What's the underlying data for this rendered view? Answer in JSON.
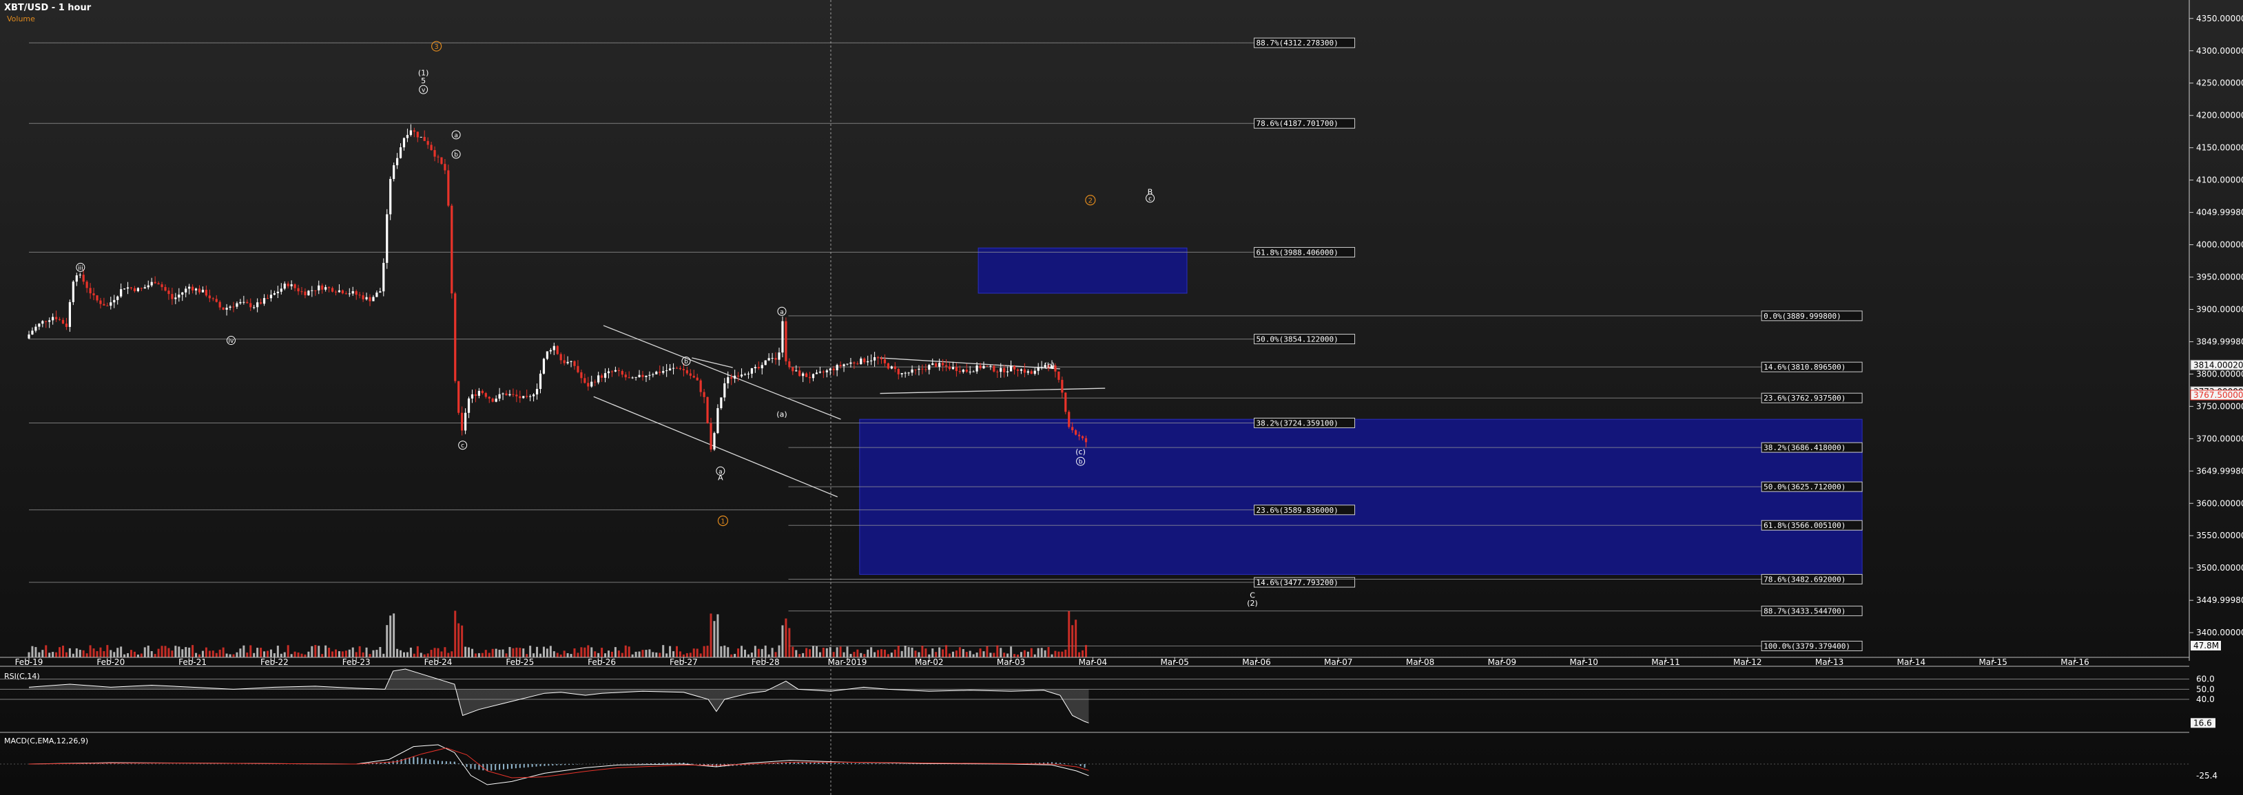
{
  "header": {
    "title": "XBT/USD - 1 hour",
    "subtitle": "Volume"
  },
  "colors": {
    "background": "#0f0f0f",
    "up_candle": "#ffffff",
    "down_candle": "#e8332a",
    "fib_box": "#13157a",
    "fib_line": "#9a9a9a",
    "wave_orange": "#e08a1e",
    "rsi_line": "#ffffff",
    "macd_line": "#ffffff",
    "signal_line": "#e8332a",
    "histogram": "#8fb3c9"
  },
  "chart_data": {
    "type": "candlestick",
    "price_axis": {
      "ylim": [
        3365,
        4370
      ],
      "ticks": [
        "4350.000000",
        "4300.000000",
        "4250.000000",
        "4200.000000",
        "4150.000000",
        "4100.000000",
        "4049.999800",
        "4000.000000",
        "3950.000000",
        "3900.000000",
        "3849.999800",
        "3800.000000",
        "3750.000000",
        "3700.000000",
        "3649.999800",
        "3600.000000",
        "3550.000000",
        "3500.000000",
        "3449.999800",
        "3400.000000"
      ],
      "tick_values": [
        4350,
        4300,
        4250,
        4200,
        4150,
        4100,
        4050,
        4000,
        3950,
        3900,
        3850,
        3800,
        3750,
        3700,
        3650,
        3600,
        3550,
        3500,
        3450,
        3400
      ],
      "price_tags": [
        {
          "label": "3814.000200",
          "value": 3814,
          "style": "plain"
        },
        {
          "label": "3773.000000",
          "value": 3773,
          "style": "plain"
        },
        {
          "label": "3767.500000",
          "value": 3767.5,
          "style": "red"
        }
      ],
      "volume_tag": "47.8M"
    },
    "time_axis": {
      "labels": [
        "Feb-19",
        "Feb-20",
        "Feb-21",
        "Feb-22",
        "Feb-23",
        "Feb-24",
        "Feb-25",
        "Feb-26",
        "Feb-27",
        "Feb-28",
        "Mar-2019",
        "Mar-02",
        "Mar-03",
        "Mar-04",
        "Mar-05",
        "Mar-06",
        "Mar-07",
        "Mar-08",
        "Mar-09",
        "Mar-10",
        "Mar-11",
        "Mar-12",
        "Mar-13",
        "Mar-14",
        "Mar-15",
        "Mar-16"
      ],
      "day_index": [
        0,
        1,
        2,
        3,
        4,
        5,
        6,
        7,
        8,
        9,
        10,
        11,
        12,
        13,
        14,
        15,
        16,
        17,
        18,
        19,
        20,
        21,
        22,
        23,
        24,
        25
      ]
    },
    "price_path": [
      [
        0.0,
        3855
      ],
      [
        0.1,
        3870
      ],
      [
        0.2,
        3880
      ],
      [
        0.35,
        3890
      ],
      [
        0.5,
        3875
      ],
      [
        0.6,
        3960
      ],
      [
        0.7,
        3945
      ],
      [
        0.85,
        3915
      ],
      [
        1.0,
        3905
      ],
      [
        1.2,
        3935
      ],
      [
        1.4,
        3930
      ],
      [
        1.6,
        3945
      ],
      [
        1.8,
        3915
      ],
      [
        2.0,
        3935
      ],
      [
        2.2,
        3925
      ],
      [
        2.4,
        3900
      ],
      [
        2.6,
        3910
      ],
      [
        2.8,
        3905
      ],
      [
        3.0,
        3920
      ],
      [
        3.2,
        3940
      ],
      [
        3.4,
        3925
      ],
      [
        3.6,
        3935
      ],
      [
        3.8,
        3930
      ],
      [
        4.0,
        3925
      ],
      [
        4.2,
        3915
      ],
      [
        4.35,
        3930
      ],
      [
        4.45,
        4100
      ],
      [
        4.55,
        4140
      ],
      [
        4.62,
        4165
      ],
      [
        4.7,
        4180
      ],
      [
        4.78,
        4170
      ],
      [
        4.9,
        4160
      ],
      [
        5.0,
        4140
      ],
      [
        5.15,
        4110
      ],
      [
        5.25,
        3790
      ],
      [
        5.32,
        3700
      ],
      [
        5.4,
        3760
      ],
      [
        5.55,
        3775
      ],
      [
        5.7,
        3760
      ],
      [
        5.85,
        3770
      ],
      [
        6.0,
        3765
      ],
      [
        6.15,
        3760
      ],
      [
        6.25,
        3780
      ],
      [
        6.35,
        3830
      ],
      [
        6.45,
        3845
      ],
      [
        6.55,
        3820
      ],
      [
        6.7,
        3815
      ],
      [
        6.85,
        3780
      ],
      [
        7.0,
        3795
      ],
      [
        7.2,
        3805
      ],
      [
        7.4,
        3790
      ],
      [
        7.6,
        3800
      ],
      [
        7.8,
        3805
      ],
      [
        8.0,
        3810
      ],
      [
        8.1,
        3800
      ],
      [
        8.2,
        3790
      ],
      [
        8.3,
        3760
      ],
      [
        8.38,
        3675
      ],
      [
        8.45,
        3740
      ],
      [
        8.55,
        3790
      ],
      [
        8.7,
        3800
      ],
      [
        8.85,
        3805
      ],
      [
        9.0,
        3810
      ],
      [
        9.1,
        3830
      ],
      [
        9.2,
        3820
      ],
      [
        9.25,
        3885
      ],
      [
        9.3,
        3810
      ],
      [
        9.45,
        3800
      ],
      [
        9.6,
        3795
      ],
      [
        9.8,
        3805
      ],
      [
        10.0,
        3815
      ],
      [
        10.2,
        3820
      ],
      [
        10.4,
        3825
      ],
      [
        10.5,
        3815
      ],
      [
        10.7,
        3800
      ],
      [
        10.9,
        3805
      ],
      [
        11.1,
        3815
      ],
      [
        11.3,
        3810
      ],
      [
        11.5,
        3805
      ],
      [
        11.7,
        3812
      ],
      [
        11.9,
        3805
      ],
      [
        12.1,
        3810
      ],
      [
        12.3,
        3800
      ],
      [
        12.45,
        3815
      ],
      [
        12.55,
        3810
      ],
      [
        12.65,
        3780
      ],
      [
        12.75,
        3720
      ],
      [
        12.85,
        3705
      ],
      [
        12.95,
        3695
      ]
    ],
    "fib_levels": [
      {
        "label": "88.7%(4312.278300)",
        "value": 4312.2783,
        "x0": 0,
        "x1": 16.2,
        "tag_x": 16.2
      },
      {
        "label": "78.6%(4187.701700)",
        "value": 4187.7017,
        "x0": 0,
        "x1": 16.2,
        "tag_x": 16.2
      },
      {
        "label": "61.8%(3988.406000)",
        "value": 3988.406,
        "x0": 0,
        "x1": 16.2,
        "tag_x": 16.2
      },
      {
        "label": "50.0%(3854.122000)",
        "value": 3854.122,
        "x0": 0,
        "x1": 16.2,
        "tag_x": 16.2
      },
      {
        "label": "38.2%(3724.359100)",
        "value": 3724.3591,
        "x0": 0,
        "x1": 16.2,
        "tag_x": 16.2
      },
      {
        "label": "23.6%(3589.836000)",
        "value": 3589.836,
        "x0": 0,
        "x1": 16.2,
        "tag_x": 16.2
      },
      {
        "label": "14.6%(3477.793200)",
        "value": 3477.7932,
        "x0": 0,
        "x1": 16.2,
        "tag_x": 16.2
      },
      {
        "label": "0.0%(3889.999800)",
        "value": 3889.9998,
        "x0": 9.28,
        "x1": 22.4,
        "tag_x": 22.4
      },
      {
        "label": "14.6%(3810.896500)",
        "value": 3810.8965,
        "x0": 9.28,
        "x1": 22.4,
        "tag_x": 22.4
      },
      {
        "label": "23.6%(3762.937500)",
        "value": 3762.9375,
        "x0": 9.28,
        "x1": 22.4,
        "tag_x": 22.4
      },
      {
        "label": "38.2%(3686.418000)",
        "value": 3686.418,
        "x0": 9.28,
        "x1": 22.4,
        "tag_x": 22.4
      },
      {
        "label": "50.0%(3625.712000)",
        "value": 3625.712,
        "x0": 9.28,
        "x1": 22.4,
        "tag_x": 22.4
      },
      {
        "label": "61.8%(3566.005100)",
        "value": 3566.0051,
        "x0": 9.28,
        "x1": 22.4,
        "tag_x": 22.4
      },
      {
        "label": "78.6%(3482.692000)",
        "value": 3482.692,
        "x0": 9.28,
        "x1": 22.4,
        "tag_x": 22.4
      },
      {
        "label": "88.7%(3433.544700)",
        "value": 3433.5447,
        "x0": 9.28,
        "x1": 22.4,
        "tag_x": 22.4
      },
      {
        "label": "100.0%(3379.379400)",
        "value": 3379.3794,
        "x0": 9.28,
        "x1": 22.4,
        "tag_x": 22.4
      }
    ],
    "zones": [
      {
        "x0": 11.6,
        "x1": 14.15,
        "y0": 3925,
        "y1": 3995
      },
      {
        "x0": 10.15,
        "x1": 22.4,
        "y0": 3490,
        "y1": 3730
      }
    ],
    "trendlines": [
      {
        "x0": 7.02,
        "y0": 3875,
        "x1": 9.92,
        "y0b": 3730,
        "y1": 3730
      },
      {
        "x0": 6.9,
        "y0": 3765,
        "x1": 9.88,
        "y1": 3610
      },
      {
        "x0": 10.4,
        "y0": 3825,
        "x1": 12.6,
        "y1": 3808
      },
      {
        "x0": 10.4,
        "y0": 3770,
        "x1": 13.15,
        "y1": 3778
      },
      {
        "x0": 8.1,
        "y0": 3825,
        "x1": 8.6,
        "y1": 3810
      }
    ],
    "wave_labels": [
      {
        "text": "(1)",
        "x": 4.82,
        "y": 4266,
        "style": "plain"
      },
      {
        "text": "5",
        "x": 4.82,
        "y": 4254,
        "style": "plain"
      },
      {
        "text": "v",
        "x": 4.82,
        "y": 4240,
        "style": "circle"
      },
      {
        "text": "3",
        "x": 4.98,
        "y": 4307,
        "style": "orange"
      },
      {
        "text": "a",
        "x": 5.22,
        "y": 4170,
        "style": "circle"
      },
      {
        "text": "b",
        "x": 5.22,
        "y": 4140,
        "style": "circle"
      },
      {
        "text": "c",
        "x": 5.3,
        "y": 3690,
        "style": "circle"
      },
      {
        "text": "iii",
        "x": 0.63,
        "y": 3965,
        "style": "circle"
      },
      {
        "text": "iv",
        "x": 2.47,
        "y": 3852,
        "style": "circle"
      },
      {
        "text": "b",
        "x": 8.03,
        "y": 3820,
        "style": "circle"
      },
      {
        "text": "a",
        "x": 8.45,
        "y": 3650,
        "style": "circle"
      },
      {
        "text": "A",
        "x": 8.45,
        "y": 3640,
        "style": "plain"
      },
      {
        "text": "1",
        "x": 8.48,
        "y": 3573,
        "style": "orange"
      },
      {
        "text": "a",
        "x": 9.2,
        "y": 3897,
        "style": "circle"
      },
      {
        "text": "(a)",
        "x": 9.2,
        "y": 3738,
        "style": "plain"
      },
      {
        "text": "(b)",
        "x": 12.47,
        "y": 3814,
        "style": "plain"
      },
      {
        "text": "(c)",
        "x": 12.85,
        "y": 3680,
        "style": "plain"
      },
      {
        "text": "b",
        "x": 12.85,
        "y": 3665,
        "style": "circle"
      },
      {
        "text": "2",
        "x": 12.97,
        "y": 4069,
        "style": "orange"
      },
      {
        "text": "B",
        "x": 13.7,
        "y": 4082,
        "style": "plain"
      },
      {
        "text": "c",
        "x": 13.7,
        "y": 4072,
        "style": "circle"
      },
      {
        "text": "C",
        "x": 14.95,
        "y": 3458,
        "style": "plain"
      },
      {
        "text": "(2)",
        "x": 14.95,
        "y": 3446,
        "style": "plain"
      }
    ],
    "rsi": {
      "label": "RSI(C,14)",
      "ticks": [
        "60.0",
        "50.0",
        "40.0"
      ],
      "tick_values": [
        60,
        50,
        40
      ],
      "current": "16.6",
      "ylim": [
        10,
        70
      ],
      "path": [
        [
          0,
          52
        ],
        [
          0.5,
          55
        ],
        [
          1,
          52
        ],
        [
          1.5,
          54
        ],
        [
          2,
          52
        ],
        [
          2.5,
          50
        ],
        [
          3,
          52
        ],
        [
          3.5,
          53
        ],
        [
          4,
          51
        ],
        [
          4.35,
          50
        ],
        [
          4.45,
          68
        ],
        [
          4.6,
          70
        ],
        [
          4.8,
          65
        ],
        [
          5.0,
          60
        ],
        [
          5.2,
          55
        ],
        [
          5.3,
          24
        ],
        [
          5.5,
          30
        ],
        [
          5.8,
          36
        ],
        [
          6.0,
          40
        ],
        [
          6.3,
          46
        ],
        [
          6.5,
          47
        ],
        [
          6.8,
          44
        ],
        [
          7.0,
          46
        ],
        [
          7.5,
          48
        ],
        [
          8.0,
          47
        ],
        [
          8.3,
          40
        ],
        [
          8.4,
          28
        ],
        [
          8.5,
          40
        ],
        [
          8.8,
          46
        ],
        [
          9.0,
          48
        ],
        [
          9.25,
          58
        ],
        [
          9.4,
          50
        ],
        [
          9.8,
          48
        ],
        [
          10.2,
          52
        ],
        [
          10.5,
          50
        ],
        [
          11.0,
          48
        ],
        [
          11.5,
          49
        ],
        [
          12.0,
          48
        ],
        [
          12.4,
          49
        ],
        [
          12.6,
          44
        ],
        [
          12.75,
          24
        ],
        [
          12.9,
          18
        ],
        [
          12.95,
          16.6
        ]
      ]
    },
    "macd": {
      "label": "MACD(C,EMA,12,26,9)",
      "ticks": [
        "-25.4"
      ],
      "tick_values": [
        -25.4
      ],
      "current": "-25.4",
      "ylim": [
        -60,
        60
      ],
      "macd_path": [
        [
          0,
          0
        ],
        [
          1,
          3
        ],
        [
          2,
          2
        ],
        [
          3,
          1
        ],
        [
          4,
          0
        ],
        [
          4.4,
          10
        ],
        [
          4.7,
          38
        ],
        [
          5.0,
          42
        ],
        [
          5.2,
          25
        ],
        [
          5.4,
          -25
        ],
        [
          5.6,
          -45
        ],
        [
          5.9,
          -38
        ],
        [
          6.3,
          -20
        ],
        [
          6.8,
          -8
        ],
        [
          7.2,
          -2
        ],
        [
          8.0,
          0
        ],
        [
          8.4,
          -6
        ],
        [
          8.8,
          2
        ],
        [
          9.3,
          8
        ],
        [
          10,
          4
        ],
        [
          11,
          1
        ],
        [
          12,
          0
        ],
        [
          12.5,
          -2
        ],
        [
          12.8,
          -15
        ],
        [
          12.95,
          -25.4
        ]
      ],
      "signal_path": [
        [
          0,
          0
        ],
        [
          1,
          2
        ],
        [
          2,
          2
        ],
        [
          3,
          1
        ],
        [
          4,
          0
        ],
        [
          4.5,
          5
        ],
        [
          4.8,
          22
        ],
        [
          5.1,
          35
        ],
        [
          5.35,
          20
        ],
        [
          5.6,
          -15
        ],
        [
          5.9,
          -30
        ],
        [
          6.3,
          -28
        ],
        [
          6.8,
          -16
        ],
        [
          7.2,
          -8
        ],
        [
          8.0,
          -2
        ],
        [
          8.4,
          -3
        ],
        [
          8.8,
          0
        ],
        [
          9.3,
          4
        ],
        [
          10,
          4
        ],
        [
          11,
          2
        ],
        [
          12,
          1
        ],
        [
          12.5,
          0
        ],
        [
          12.8,
          -6
        ],
        [
          12.95,
          -14
        ]
      ]
    }
  }
}
